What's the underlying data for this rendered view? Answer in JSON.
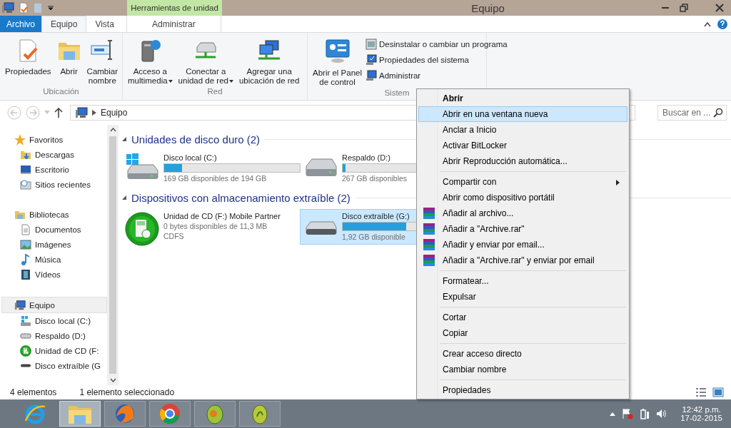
{
  "title_bar": {
    "contextual_tab": "Herramientas de unidad",
    "title": "Equipo"
  },
  "ribbon": {
    "tabs": [
      {
        "label": "Archivo",
        "kind": "file",
        "selected": false
      },
      {
        "label": "Equipo",
        "kind": "tab",
        "selected": true
      },
      {
        "label": "Vista",
        "kind": "tab",
        "selected": false
      },
      {
        "label": "Administrar",
        "kind": "contextual",
        "selected": false
      }
    ],
    "groups": [
      {
        "label": "Ubicación",
        "buttons": [
          {
            "lines": [
              "Propiedades"
            ],
            "dropdown": false
          },
          {
            "lines": [
              "Abrir"
            ],
            "dropdown": false
          },
          {
            "lines": [
              "Cambiar",
              "nombre"
            ],
            "dropdown": false
          }
        ]
      },
      {
        "label": "Red",
        "buttons": [
          {
            "lines": [
              "Acceso a",
              "multimedia"
            ],
            "dropdown": true
          },
          {
            "lines": [
              "Conectar a",
              "unidad de red"
            ],
            "dropdown": true
          },
          {
            "lines": [
              "Agregar una",
              "ubicación de red"
            ],
            "dropdown": false
          }
        ]
      },
      {
        "label": "Sistem",
        "buttons": [
          {
            "lines": [
              "Abrir el Panel",
              "de control"
            ],
            "dropdown": false
          }
        ],
        "small_buttons": [
          "Desinstalar o cambiar un programa",
          "Propiedades del sistema",
          "Administrar"
        ]
      }
    ]
  },
  "address_bar": {
    "path": "Equipo",
    "search": {
      "placeholder": "Buscar en ..."
    }
  },
  "sidebar": {
    "sections": [
      {
        "label": "Favoritos",
        "selected": false,
        "children": [
          {
            "label": "Descargas",
            "selected": false
          },
          {
            "label": "Escritorio",
            "selected": false
          },
          {
            "label": "Sitios recientes",
            "selected": false
          }
        ]
      },
      {
        "label": "Bibliotecas",
        "selected": false,
        "children": [
          {
            "label": "Documentos",
            "selected": false
          },
          {
            "label": "Imágenes",
            "selected": false
          },
          {
            "label": "Música",
            "selected": false
          },
          {
            "label": "Vídeos",
            "selected": false
          }
        ]
      },
      {
        "label": "Equipo",
        "selected": true,
        "children": [
          {
            "label": "Disco local (C:)",
            "selected": false
          },
          {
            "label": "Respaldo (D:)",
            "selected": false
          },
          {
            "label": "Unidad de CD (F:",
            "selected": false
          },
          {
            "label": "Disco extraíble (G",
            "selected": false
          }
        ]
      }
    ]
  },
  "content": {
    "sections": [
      {
        "title": "Unidades de disco duro (2)",
        "expanded": true,
        "items": [
          {
            "kind": "hdd",
            "name": "Disco local (C:)",
            "level": 0.13,
            "detail": "169 GB disponibles de 194 GB",
            "selected": false
          },
          {
            "kind": "hdd",
            "name": "Respaldo (D:)",
            "level": 0.02,
            "detail": "267 GB disponibles",
            "selected": false
          }
        ]
      },
      {
        "title": "Dispositivos con almacenamiento extraíble (2)",
        "expanded": true,
        "items": [
          {
            "kind": "cd",
            "name": "Unidad de CD (F:) Mobile Partner",
            "detail": "0 bytes disponibles de 11,3 MB",
            "extra": "CDFS",
            "selected": false
          },
          {
            "kind": "removable",
            "name": "Disco extraíble (G:)",
            "level": 0.47,
            "detail": "1,92 GB disponible",
            "selected": true
          }
        ]
      }
    ]
  },
  "status_bar": {
    "count": "4 elementos",
    "selection": "1 elemento seleccionado"
  },
  "context_menu": {
    "groups": [
      [
        {
          "label": "Abrir",
          "kind": "default",
          "selected": false
        },
        {
          "label": "Abrir en una ventana nueva",
          "kind": "plain",
          "selected": true
        },
        {
          "label": "Anclar a Inicio",
          "kind": "plain",
          "selected": false
        },
        {
          "label": "Activar BitLocker",
          "kind": "plain",
          "selected": false
        },
        {
          "label": "Abrir Reproducción automática...",
          "kind": "plain",
          "selected": false
        }
      ],
      [
        {
          "label": "Compartir con",
          "kind": "submenu",
          "selected": false
        },
        {
          "label": "Abrir como dispositivo portátil",
          "kind": "plain",
          "selected": false
        },
        {
          "label": "Añadir al archivo...",
          "kind": "archive",
          "selected": false
        },
        {
          "label": "Añadir a \"Archive.rar\"",
          "kind": "archive",
          "selected": false
        },
        {
          "label": "Añadir y enviar por email...",
          "kind": "archive",
          "selected": false
        },
        {
          "label": "Añadir a \"Archive.rar\" y enviar por email",
          "kind": "archive",
          "selected": false
        }
      ],
      [
        {
          "label": "Formatear...",
          "kind": "plain",
          "selected": false
        },
        {
          "label": "Expulsar",
          "kind": "plain",
          "selected": false
        }
      ],
      [
        {
          "label": "Cortar",
          "kind": "plain",
          "selected": false
        },
        {
          "label": "Copiar",
          "kind": "plain",
          "selected": false
        }
      ],
      [
        {
          "label": "Crear acceso directo",
          "kind": "plain",
          "selected": false
        },
        {
          "label": "Cambiar nombre",
          "kind": "plain",
          "selected": false
        }
      ],
      [
        {
          "label": "Propiedades",
          "kind": "plain",
          "selected": false
        }
      ]
    ]
  },
  "taskbar": {
    "apps": [
      {
        "running": false,
        "selected": false
      },
      {
        "running": true,
        "selected": true
      },
      {
        "running": true,
        "selected": false
      },
      {
        "running": true,
        "selected": false
      },
      {
        "running": true,
        "selected": false
      },
      {
        "running": true,
        "selected": false
      }
    ],
    "clock": {
      "time": "12:42 p.m.",
      "date": "17-02-2015"
    }
  }
}
